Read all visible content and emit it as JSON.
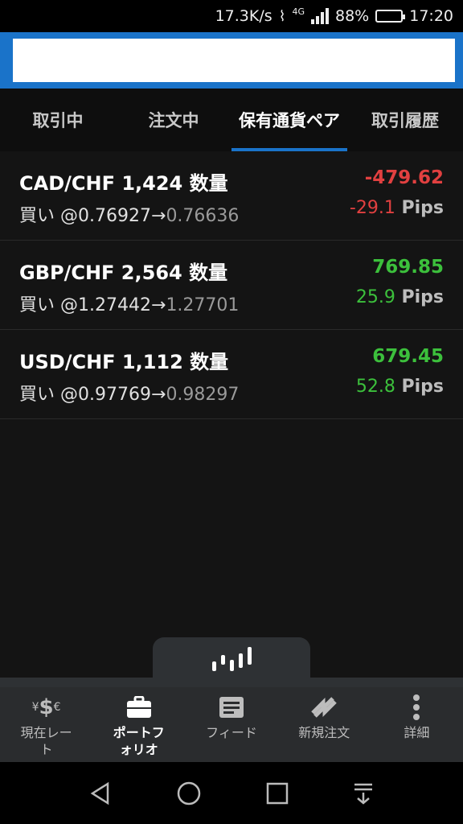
{
  "statusbar": {
    "speed": "17.3K/s",
    "network": "4G",
    "battery": "88%",
    "time": "17:20"
  },
  "search": {
    "value": "",
    "placeholder": ""
  },
  "tabs": [
    {
      "label": "取引中"
    },
    {
      "label": "注文中"
    },
    {
      "label": "保有通貨ペア",
      "active": true
    },
    {
      "label": "取引履歴"
    }
  ],
  "positions": [
    {
      "pair": "CAD/CHF 1,424 数量",
      "side": "買い",
      "entry": "@0.76927→",
      "current": "0.76636",
      "pl": "-479.62",
      "pips": "-29.1",
      "pips_unit": " Pips",
      "sign": "neg"
    },
    {
      "pair": "GBP/CHF 2,564 数量",
      "side": "買い",
      "entry": "@1.27442→",
      "current": "1.27701",
      "pl": "769.85",
      "pips": "25.9",
      "pips_unit": " Pips",
      "sign": "pos"
    },
    {
      "pair": "USD/CHF 1,112 数量",
      "side": "買い",
      "entry": "@0.97769→",
      "current": "0.98297",
      "pl": "679.45",
      "pips": "52.8",
      "pips_unit": " Pips",
      "sign": "pos"
    }
  ],
  "bottomnav": [
    {
      "label": "現在レー",
      "label2": "ト",
      "icon": "currency-rates-icon"
    },
    {
      "label": "ポートフ",
      "label2": "ォリオ",
      "icon": "briefcase-icon",
      "active": true
    },
    {
      "label": "フィード",
      "label2": "",
      "icon": "feed-icon"
    },
    {
      "label": "新規注文",
      "label2": "",
      "icon": "new-order-icon"
    },
    {
      "label": "詳細",
      "label2": "",
      "icon": "more-vertical-icon"
    }
  ],
  "colors": {
    "accent": "#1a73c9",
    "negative": "#e14040",
    "positive": "#3cc03c"
  }
}
